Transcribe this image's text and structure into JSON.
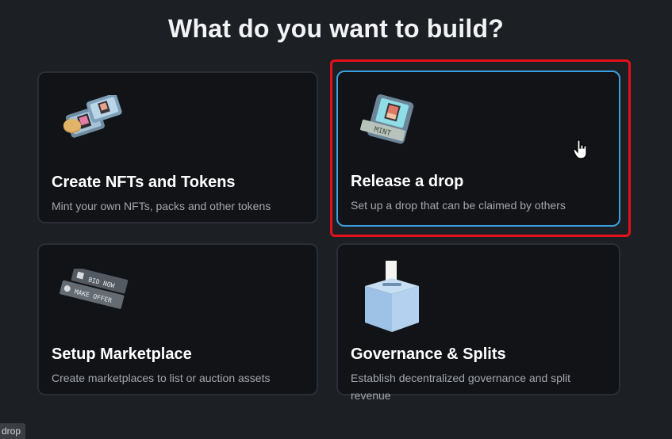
{
  "page": {
    "title": "What do you want to build?"
  },
  "cards": [
    {
      "title": "Create NFTs and Tokens",
      "description": "Mint your own NFTs, packs and other tokens",
      "icon": "nft-cards-icon"
    },
    {
      "title": "Release a drop",
      "description": "Set up a drop that can be claimed by others",
      "icon": "mint-card-icon",
      "mint_text": "MINT"
    },
    {
      "title": "Setup Marketplace",
      "description": "Create marketplaces to list or auction assets",
      "icon": "marketplace-tags-icon",
      "bid_text": "BID NOW",
      "offer_text": "MAKE OFFER"
    },
    {
      "title": "Governance & Splits",
      "description": "Establish decentralized governance and split revenue",
      "icon": "ballot-box-icon"
    }
  ],
  "tooltip": {
    "text": "drop"
  },
  "colors": {
    "background": "#1c1f24",
    "card": "#111317",
    "active_border": "#3b9fe0",
    "highlight": "#e3121a"
  }
}
